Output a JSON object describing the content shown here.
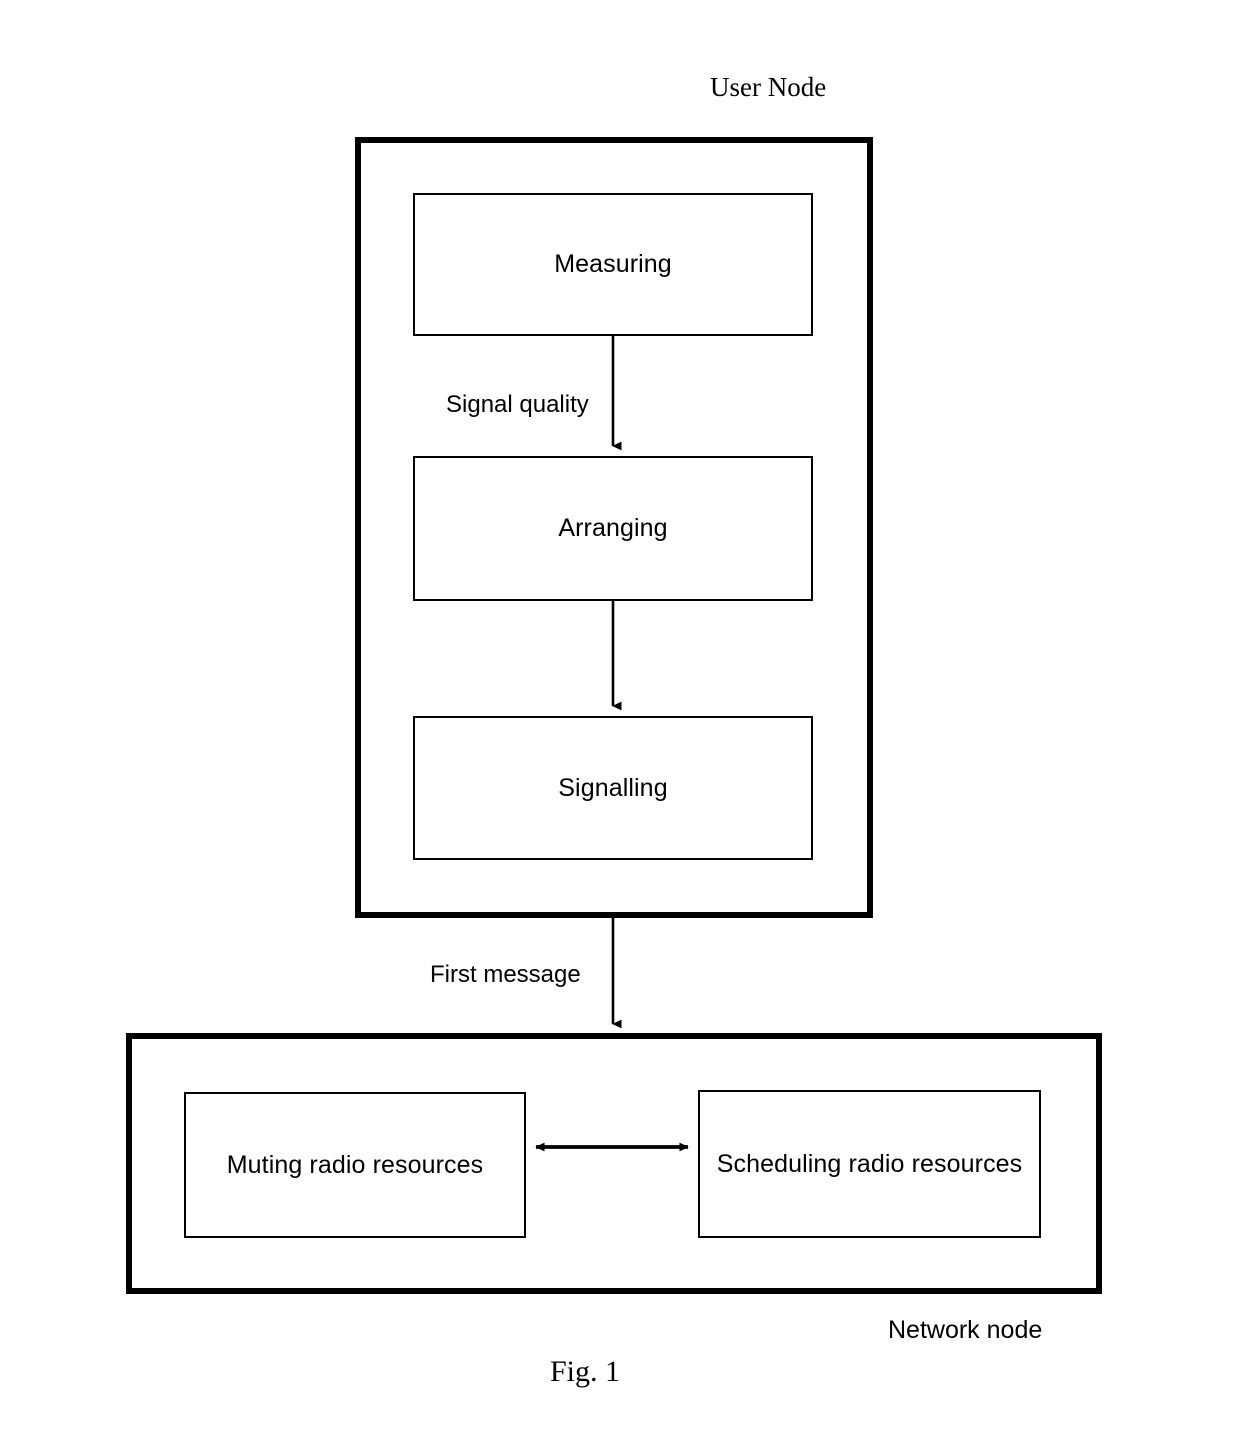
{
  "figure": {
    "caption": "Fig. 1",
    "user_node_title": "User Node",
    "network_node_title": "Network node"
  },
  "user_node": {
    "title": "User Node",
    "steps": [
      {
        "label": "Measuring"
      },
      {
        "label": "Arranging"
      },
      {
        "label": "Signalling"
      }
    ],
    "internal_edges": [
      {
        "label": "Signal quality",
        "from": "Measuring",
        "to": "Arranging"
      },
      {
        "label": "",
        "from": "Arranging",
        "to": "Signalling"
      }
    ]
  },
  "network_node": {
    "title": "Network node",
    "blocks": [
      {
        "label": "Muting radio resources"
      },
      {
        "label": "Scheduling radio resources"
      }
    ],
    "internal_edges": [
      {
        "label": "",
        "from": "Muting radio resources",
        "to": "Scheduling radio resources",
        "bidirectional": true
      }
    ]
  },
  "cross_edge": {
    "label": "First message",
    "from": "User Node",
    "to": "Network node"
  },
  "colors": {
    "stroke": "#000000",
    "fill": "#ffffff",
    "text": "#000000"
  }
}
